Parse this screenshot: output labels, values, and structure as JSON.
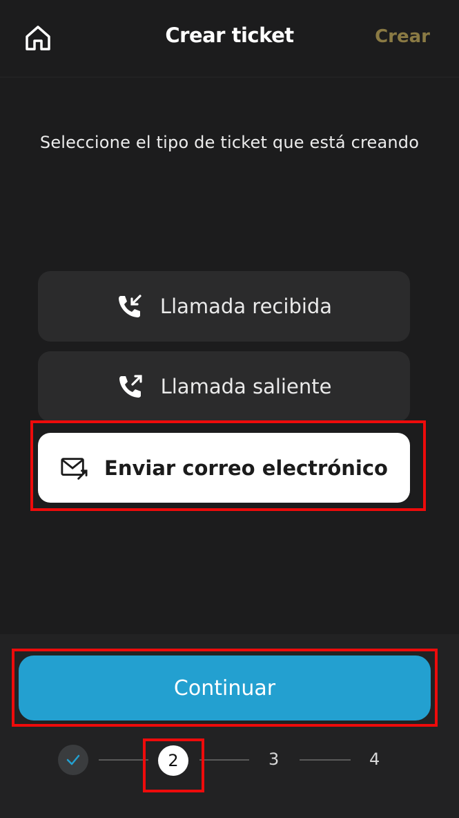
{
  "header": {
    "title": "Crear ticket",
    "create_label": "Crear",
    "home_icon": "home-icon"
  },
  "prompt": "Seleccione el tipo de ticket que está creando",
  "options": [
    {
      "label": "Llamada recibida",
      "icon": "incoming-call-icon"
    },
    {
      "label": "Llamada saliente",
      "icon": "outgoing-call-icon"
    },
    {
      "label": "Enviar correo electrónico",
      "icon": "send-email-icon",
      "selected": true
    }
  ],
  "continue_label": "Continuar",
  "stepper": {
    "steps": [
      "✓",
      "2",
      "3",
      "4"
    ],
    "current": 2
  },
  "colors": {
    "background": "#1c1c1d",
    "accent": "#23a0d0",
    "create_link": "#8a7a44",
    "highlight": "#ee0b0b"
  }
}
